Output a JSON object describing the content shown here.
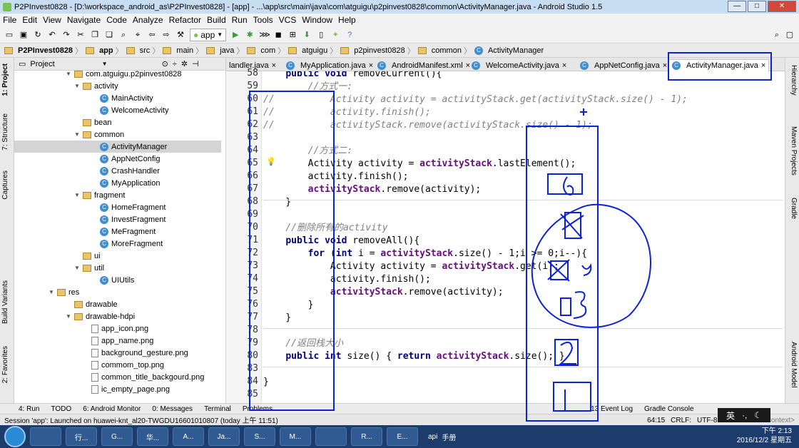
{
  "window": {
    "title": "P2PInvest0828 - [D:\\workspace_android_as\\P2PInvest0828] - [app] - ...\\app\\src\\main\\java\\com\\atguigu\\p2pinvest0828\\common\\ActivityManager.java - Android Studio 1.5",
    "min": "—",
    "max": "□",
    "close": "✕"
  },
  "menu": [
    "File",
    "Edit",
    "View",
    "Navigate",
    "Code",
    "Analyze",
    "Refactor",
    "Build",
    "Run",
    "Tools",
    "VCS",
    "Window",
    "Help"
  ],
  "toolbar": {
    "run_config": "app"
  },
  "breadcrumb": [
    "P2PInvest0828",
    "app",
    "src",
    "main",
    "java",
    "com",
    "atguigu",
    "p2pinvest0828",
    "common",
    "ActivityManager"
  ],
  "project_panel": {
    "title": "Project",
    "tree": [
      {
        "label": "com.atguigu.p2pinvest0828",
        "indent": 6,
        "kind": "folder",
        "arrow": "▼"
      },
      {
        "label": "activity",
        "indent": 7,
        "kind": "folder",
        "arrow": "▼"
      },
      {
        "label": "MainActivity",
        "indent": 9,
        "kind": "class",
        "arrow": ""
      },
      {
        "label": "WelcomeActivity",
        "indent": 9,
        "kind": "class",
        "arrow": ""
      },
      {
        "label": "bean",
        "indent": 7,
        "kind": "folder",
        "arrow": ""
      },
      {
        "label": "common",
        "indent": 7,
        "kind": "folder",
        "arrow": "▼"
      },
      {
        "label": "ActivityManager",
        "indent": 9,
        "kind": "class",
        "arrow": "",
        "selected": true
      },
      {
        "label": "AppNetConfig",
        "indent": 9,
        "kind": "class",
        "arrow": ""
      },
      {
        "label": "CrashHandler",
        "indent": 9,
        "kind": "class",
        "arrow": ""
      },
      {
        "label": "MyApplication",
        "indent": 9,
        "kind": "class",
        "arrow": ""
      },
      {
        "label": "fragment",
        "indent": 7,
        "kind": "folder",
        "arrow": "▼"
      },
      {
        "label": "HomeFragment",
        "indent": 9,
        "kind": "class",
        "arrow": ""
      },
      {
        "label": "InvestFragment",
        "indent": 9,
        "kind": "class",
        "arrow": ""
      },
      {
        "label": "MeFragment",
        "indent": 9,
        "kind": "class",
        "arrow": ""
      },
      {
        "label": "MoreFragment",
        "indent": 9,
        "kind": "class",
        "arrow": ""
      },
      {
        "label": "ui",
        "indent": 7,
        "kind": "folder",
        "arrow": ""
      },
      {
        "label": "util",
        "indent": 7,
        "kind": "folder",
        "arrow": "▼"
      },
      {
        "label": "UIUtils",
        "indent": 9,
        "kind": "class",
        "arrow": ""
      },
      {
        "label": "res",
        "indent": 4,
        "kind": "folder",
        "arrow": "▼"
      },
      {
        "label": "drawable",
        "indent": 6,
        "kind": "folder",
        "arrow": ""
      },
      {
        "label": "drawable-hdpi",
        "indent": 6,
        "kind": "folder",
        "arrow": "▼"
      },
      {
        "label": "app_icon.png",
        "indent": 8,
        "kind": "png",
        "arrow": ""
      },
      {
        "label": "app_name.png",
        "indent": 8,
        "kind": "png",
        "arrow": ""
      },
      {
        "label": "background_gesture.png",
        "indent": 8,
        "kind": "png",
        "arrow": ""
      },
      {
        "label": "commom_top.png",
        "indent": 8,
        "kind": "png",
        "arrow": ""
      },
      {
        "label": "common_title_backgourd.png",
        "indent": 8,
        "kind": "png",
        "arrow": ""
      },
      {
        "label": "ic_empty_page.png",
        "indent": 8,
        "kind": "png",
        "arrow": ""
      }
    ]
  },
  "editor_tabs": [
    {
      "label": "landler.java",
      "active": false
    },
    {
      "label": "MyApplication.java",
      "active": false
    },
    {
      "label": "AndroidManifest.xml",
      "active": false
    },
    {
      "label": "WelcomeActivity.java",
      "active": false
    },
    {
      "label": "AppNetConfig.java",
      "active": false
    },
    {
      "label": "ActivityManager.java",
      "active": true
    }
  ],
  "code_lines": [
    {
      "n": "58",
      "text": "    public void removeCurrent(){"
    },
    {
      "n": "59",
      "text": "        //方式一:"
    },
    {
      "n": "60",
      "text": "//          Activity activity = activityStack.get(activityStack.size() - 1);"
    },
    {
      "n": "61",
      "text": "//          activity.finish();"
    },
    {
      "n": "62",
      "text": "//          activityStack.remove(activityStack.size() - 1);"
    },
    {
      "n": "63",
      "text": ""
    },
    {
      "n": "64",
      "text": "        //方式二:"
    },
    {
      "n": "65",
      "text": "        Activity activity = activityStack.lastElement();"
    },
    {
      "n": "66",
      "text": "        activity.finish();"
    },
    {
      "n": "67",
      "text": "        activityStack.remove(activity);"
    },
    {
      "n": "68",
      "text": "    }"
    },
    {
      "n": "69",
      "text": ""
    },
    {
      "n": "70",
      "text": "    //删除所有的activity"
    },
    {
      "n": "71",
      "text": "    public void removeAll(){"
    },
    {
      "n": "72",
      "text": "        for (int i = activityStack.size() - 1;i >= 0;i--){"
    },
    {
      "n": "73",
      "text": "            Activity activity = activityStack.get(i);"
    },
    {
      "n": "74",
      "text": "            activity.finish();"
    },
    {
      "n": "75",
      "text": "            activityStack.remove(activity);"
    },
    {
      "n": "76",
      "text": "        }"
    },
    {
      "n": "77",
      "text": "    }"
    },
    {
      "n": "78",
      "text": ""
    },
    {
      "n": "79",
      "text": "    //返回栈大小"
    },
    {
      "n": "80",
      "text": "    public int size() { return activityStack.size(); }"
    },
    {
      "n": "83",
      "text": ""
    },
    {
      "n": "84",
      "text": "}"
    },
    {
      "n": "85",
      "text": ""
    }
  ],
  "left_tool_tabs": [
    "1: Project",
    "7: Structure",
    "Captures",
    "Build Variants",
    "2: Favorites"
  ],
  "right_tool_tabs": [
    "Hierarchy",
    "Maven Projects",
    "Gradle",
    "Android Model"
  ],
  "bottom_tools": [
    "4: Run",
    "TODO",
    "6: Android Monitor",
    "0: Messages",
    "Terminal",
    "Problems",
    "13 Event Log",
    "Gradle Console"
  ],
  "status": {
    "message": "Session 'app': Launched on huawei-knt_al20-TWGDU16601010807 (today 上午 11:51)",
    "position": "64:15",
    "line_sep": "CRLF:",
    "encoding": "UTF-8:",
    "context": "Context: <no context>"
  },
  "ime": {
    "lang": "英"
  },
  "taskbar": {
    "apps": [
      "",
      "行...",
      "G...",
      "华...",
      "A...",
      "Ja...",
      "S...",
      "M...",
      "",
      "R...",
      "E..."
    ],
    "tray_app": "api",
    "tray_app2": "手册",
    "time": "下午 2:13",
    "date": "2016/12/2 星期五"
  },
  "colors": {
    "annotation": "#0b22d6",
    "keyword": "#000080",
    "comment": "#808080",
    "field": "#660e7a"
  }
}
